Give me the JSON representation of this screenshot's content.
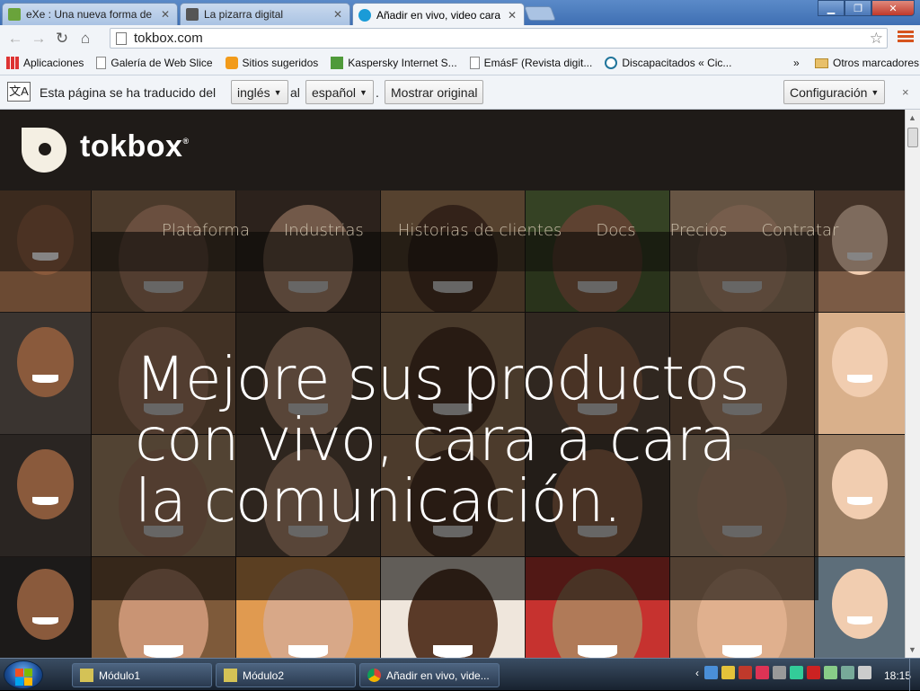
{
  "window": {
    "tabs": [
      {
        "title": "eXe : Una nueva forma de",
        "active": false
      },
      {
        "title": "La pizarra digital",
        "active": false
      },
      {
        "title": "Añadir en vivo, video cara",
        "active": true
      }
    ]
  },
  "toolbar": {
    "url": "tokbox.com"
  },
  "bookmarks": {
    "items": [
      "Aplicaciones",
      "Galería de Web Slice",
      "Sitios sugeridos",
      "Kaspersky Internet S...",
      "EmásF (Revista digit...",
      "Discapacitados « Cic..."
    ],
    "more": "»",
    "other": "Otros marcadores"
  },
  "translate_bar": {
    "prefix": "Esta página se ha traducido del",
    "from_lang": "inglés",
    "connector": "al",
    "to_lang": "español",
    "dot": ".",
    "show_original": "Mostrar original",
    "settings": "Configuración",
    "close": "×"
  },
  "site": {
    "logo": "tokbox",
    "logo_mark": "®",
    "nav": [
      "Plataforma",
      "Industrias",
      "Historias de clientes",
      "Docs",
      "Precios",
      "Contratar"
    ],
    "hero_lines": [
      "Mejore sus productos",
      "con vivo, cara a cara",
      "la comunicación."
    ]
  },
  "taskbar": {
    "tasks": [
      "Módulo1",
      "Módulo2",
      "Añadir en vivo, vide..."
    ],
    "clock": "18:15"
  },
  "colors": {
    "header_bg": "#1f1b18",
    "nav_text": "#c9bda8",
    "chrome_bg": "#f1f4f8",
    "taskbar": "#24344a"
  }
}
